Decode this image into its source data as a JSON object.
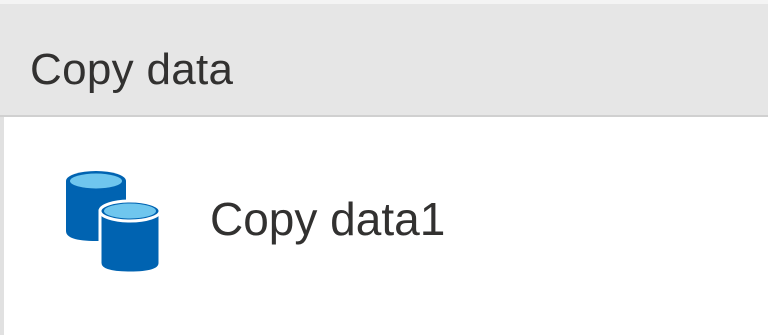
{
  "panel": {
    "title": "Copy data"
  },
  "activity": {
    "label": "Copy data1",
    "icon": "copy-data-icon"
  },
  "colors": {
    "header_bg": "#e6e6e6",
    "icon_blue_dark": "#0063b1",
    "icon_blue_light": "#6fc6ee",
    "text": "#323130"
  }
}
